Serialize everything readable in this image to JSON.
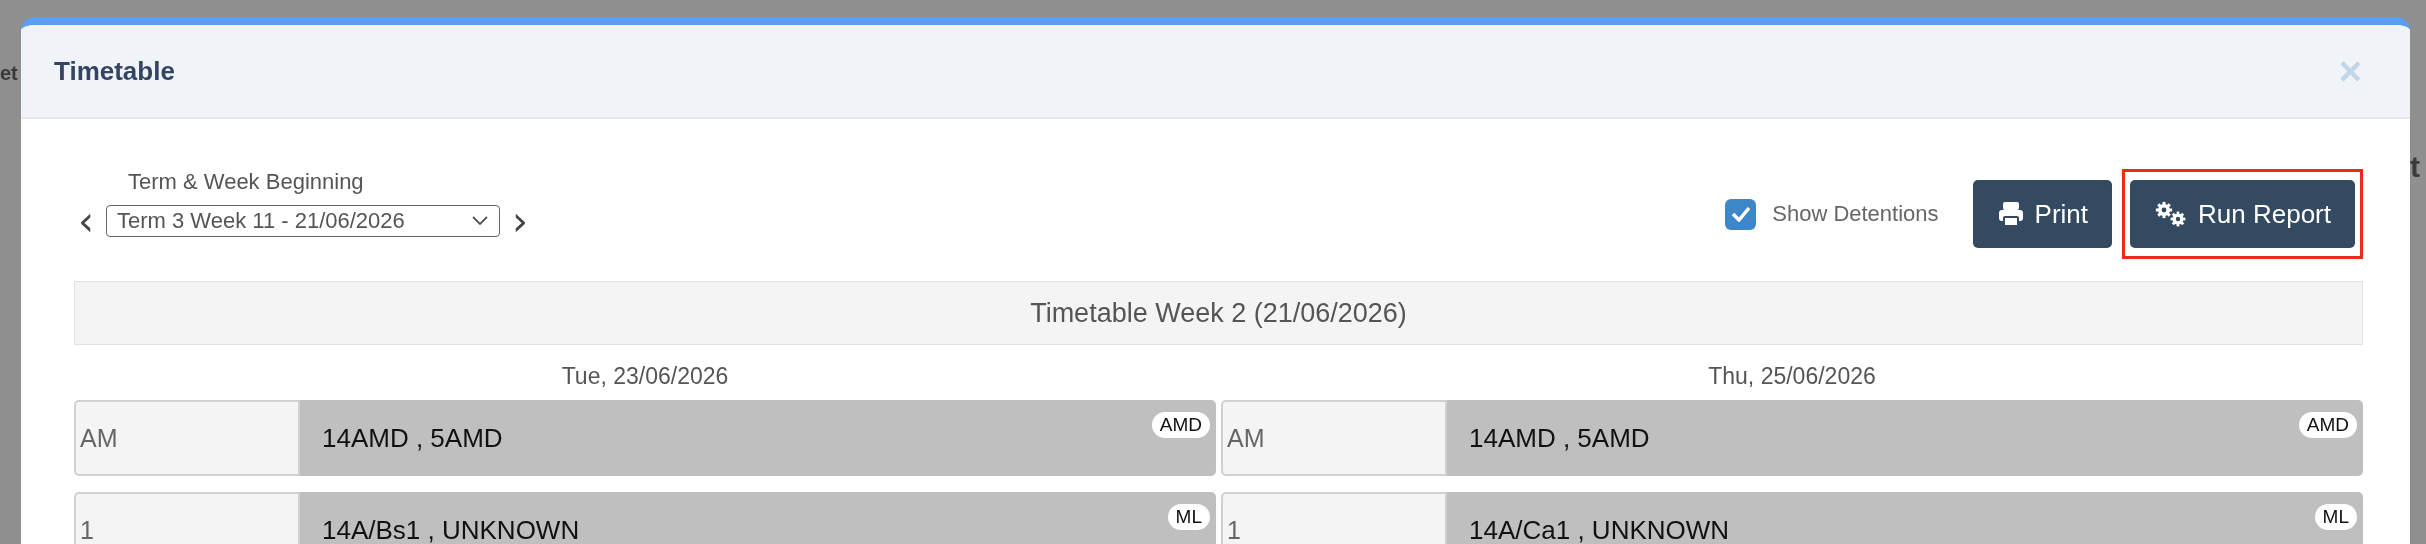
{
  "backdrop": {
    "left_text": "et",
    "right_text": "t"
  },
  "dialog": {
    "title": "Timetable",
    "close": "×"
  },
  "filter": {
    "label": "Term & Week Beginning",
    "prev": "‹",
    "value": "Term 3 Week 11 - 21/06/2026",
    "next": "›"
  },
  "show_detentions": {
    "label": "Show Detentions",
    "checked": true
  },
  "buttons": [
    {
      "label": "Print",
      "kind": "print",
      "highlighted": false
    },
    {
      "label": "Run Report",
      "kind": "report",
      "highlighted": true
    }
  ],
  "week_heading": "Timetable Week 2 (21/06/2026)",
  "days": [
    {
      "date": "Tue, 23/06/2026",
      "periods": [
        {
          "period": "AM",
          "classes": "14AMD , 5AMD",
          "badge": "AMD"
        },
        {
          "period": "1",
          "classes": "14A/Bs1 , UNKNOWN",
          "badge": "ML"
        }
      ]
    },
    {
      "date": "Thu, 25/06/2026",
      "periods": [
        {
          "period": "AM",
          "classes": "14AMD , 5AMD",
          "badge": "AMD"
        },
        {
          "period": "1",
          "classes": "14A/Ca1 , UNKNOWN",
          "badge": "ML"
        }
      ]
    }
  ]
}
